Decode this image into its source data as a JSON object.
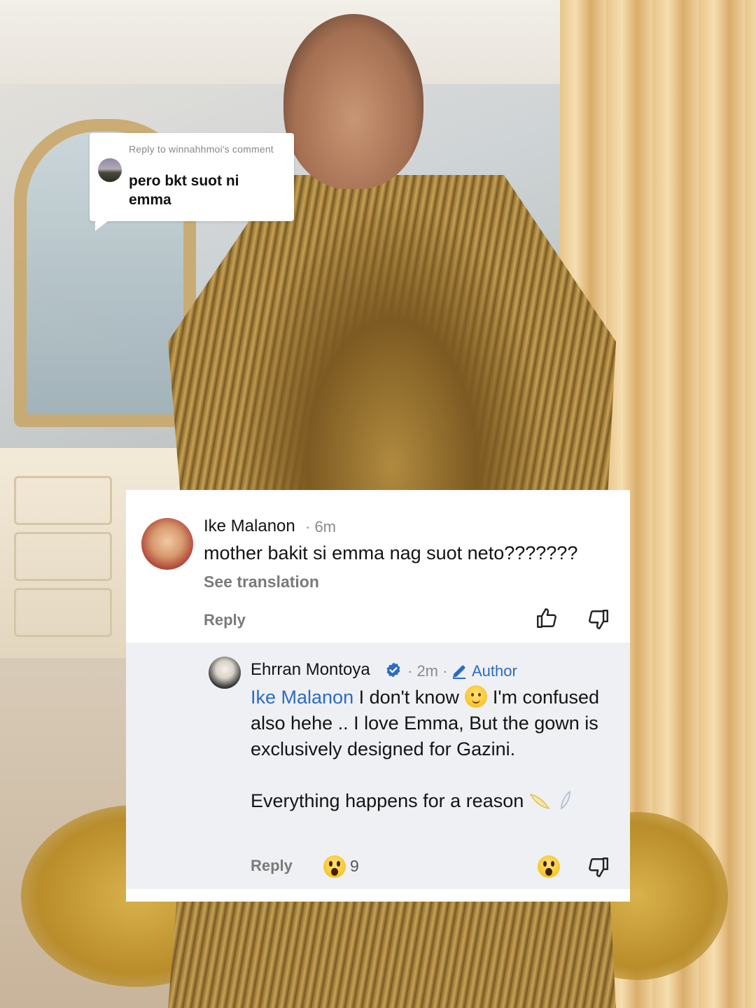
{
  "reply_sticker": {
    "meta": "Reply to winnahhmoi's comment",
    "text": "pero bkt suot ni emma",
    "avatar_icon": "user-avatar"
  },
  "comments": [
    {
      "author": "Ike Malanon",
      "time": "· 6m",
      "text": "mother bakit si emma nag suot neto???????",
      "see_translation": "See translation",
      "reply_label": "Reply",
      "like_icon": "thumbs-up-icon",
      "dislike_icon": "thumbs-down-icon"
    },
    {
      "author": "Ehrran Montoya",
      "verified_icon": "verified-badge-icon",
      "time": "· 2m ·",
      "author_badge": "Author",
      "author_badge_icon": "pencil-icon",
      "mention": "Ike Malanon",
      "text_part1": " I don't know",
      "text_part2": "I'm confused also hehe .. I love Emma, But the gown is exclusively designed for Gazini.",
      "text_para2": "Everything happens for a reason",
      "reply_label": "Reply",
      "reaction_icon": "surprised-face-icon",
      "reaction_count": "9",
      "dislike_icon": "thumbs-down-icon"
    }
  ],
  "colors": {
    "link": "#2b6cc4",
    "secondary_text": "#7a7a7a",
    "reply_background": "#eff0f3"
  }
}
